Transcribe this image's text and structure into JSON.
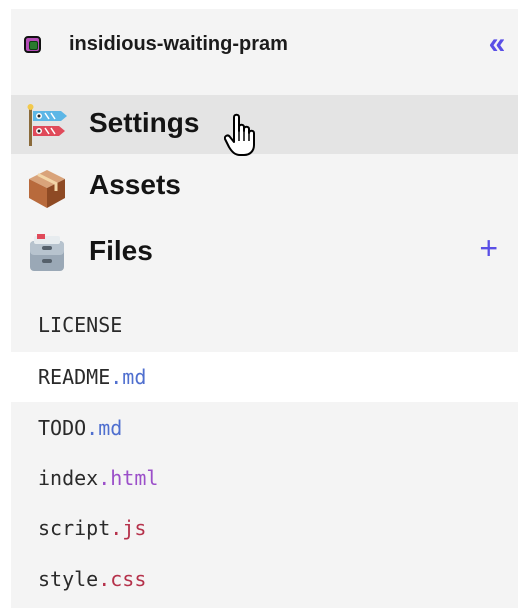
{
  "project": {
    "name": "insidious-waiting-pram",
    "icon": "project-icon",
    "collapse_glyph": "«"
  },
  "nav": {
    "settings_label": "Settings",
    "assets_label": "Assets",
    "files_label": "Files",
    "add_glyph": "+"
  },
  "files": [
    {
      "base": "LICENSE",
      "ext": "",
      "ext_color": "#2a2a2a"
    },
    {
      "base": "README",
      "ext": ".md",
      "ext_color": "#4f6fcf",
      "selected": true
    },
    {
      "base": "TODO",
      "ext": ".md",
      "ext_color": "#4f6fcf"
    },
    {
      "base": "index",
      "ext": ".html",
      "ext_color": "#9b4fc9"
    },
    {
      "base": "script",
      "ext": ".js",
      "ext_color": "#b5314a"
    },
    {
      "base": "style",
      "ext": ".css",
      "ext_color": "#b5314a"
    }
  ],
  "colors": {
    "accent": "#5a4fe6",
    "sidebar_bg": "#f4f4f4",
    "active_bg": "#e4e4e4"
  }
}
